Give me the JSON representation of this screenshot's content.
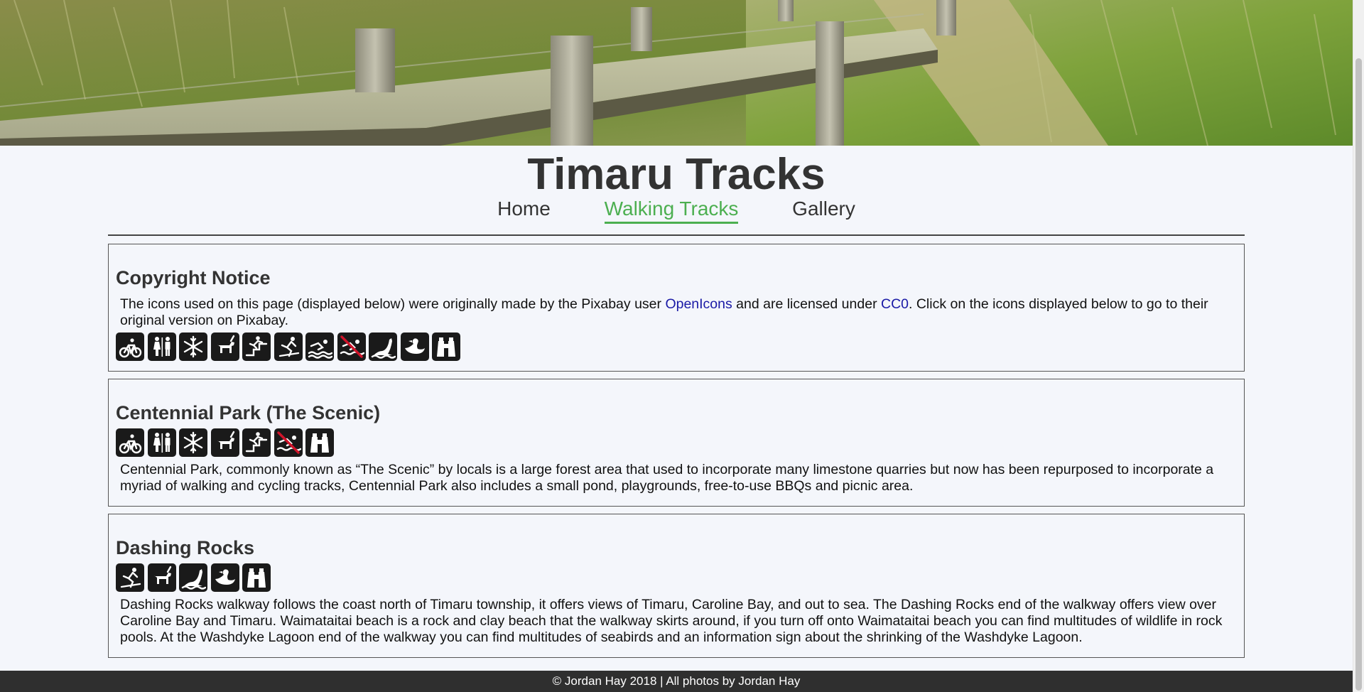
{
  "site": {
    "title": "Timaru Tracks",
    "footer": "© Jordan Hay 2018 | All photos by Jordan Hay"
  },
  "nav": {
    "items": [
      {
        "label": "Home",
        "active": false
      },
      {
        "label": "Walking Tracks",
        "active": true
      },
      {
        "label": "Gallery",
        "active": false
      }
    ]
  },
  "colors": {
    "accent": "#4caf50",
    "link": "#1a1aa6",
    "footer_bg": "#2f2f2f",
    "icon_bg": "#1a1a1a",
    "page_bg": "#f4f6fb"
  },
  "copyright": {
    "heading": "Copyright Notice",
    "text_before_user": "The icons used on this page (displayed below) were originally made by the Pixabay user ",
    "user_link": "OpenIcons",
    "text_middle": " and are licensed under ",
    "license_link": "CC0",
    "text_after": ". Click on the icons displayed below to go to their original version on Pixabay.",
    "icons": [
      "bicycle-icon",
      "toilets-icon",
      "snowflake-icon",
      "dog-walking-icon",
      "falling-hazard-icon",
      "slippery-icon",
      "swimming-icon",
      "no-swimming-icon",
      "seal-icon",
      "duck-icon",
      "binoculars-icon"
    ]
  },
  "centennial": {
    "heading": "Centennial Park (The Scenic)",
    "description": "Centennial Park, commonly known as “The Scenic” by locals is a large forest area that used to incorporate many limestone quarries but now has been repurposed to incorporate a myriad of walking and cycling tracks, Centennial Park also includes a small pond, playgrounds, free-to-use BBQs and picnic area.",
    "icons": [
      "bicycle-icon",
      "toilets-icon",
      "snowflake-icon",
      "dog-walking-icon",
      "falling-hazard-icon",
      "no-swimming-icon",
      "binoculars-icon"
    ]
  },
  "dashing": {
    "heading": "Dashing Rocks",
    "description": "Dashing Rocks walkway follows the coast north of Timaru township, it offers views of Timaru, Caroline Bay, and out to sea. The Dashing Rocks end of the walkway offers view over Caroline Bay and Timaru. Waimataitai beach is a rock and clay beach that the walkway skirts around, if you turn off onto Waimataitai beach you can find multitudes of wildlife in rock pools. At the Washdyke Lagoon end of the walkway you can find multitudes of seabirds and an information sign about the shrinking of the Washdyke Lagoon.",
    "icons": [
      "slippery-icon",
      "dog-walking-icon",
      "seal-icon",
      "duck-icon",
      "binoculars-icon"
    ]
  }
}
